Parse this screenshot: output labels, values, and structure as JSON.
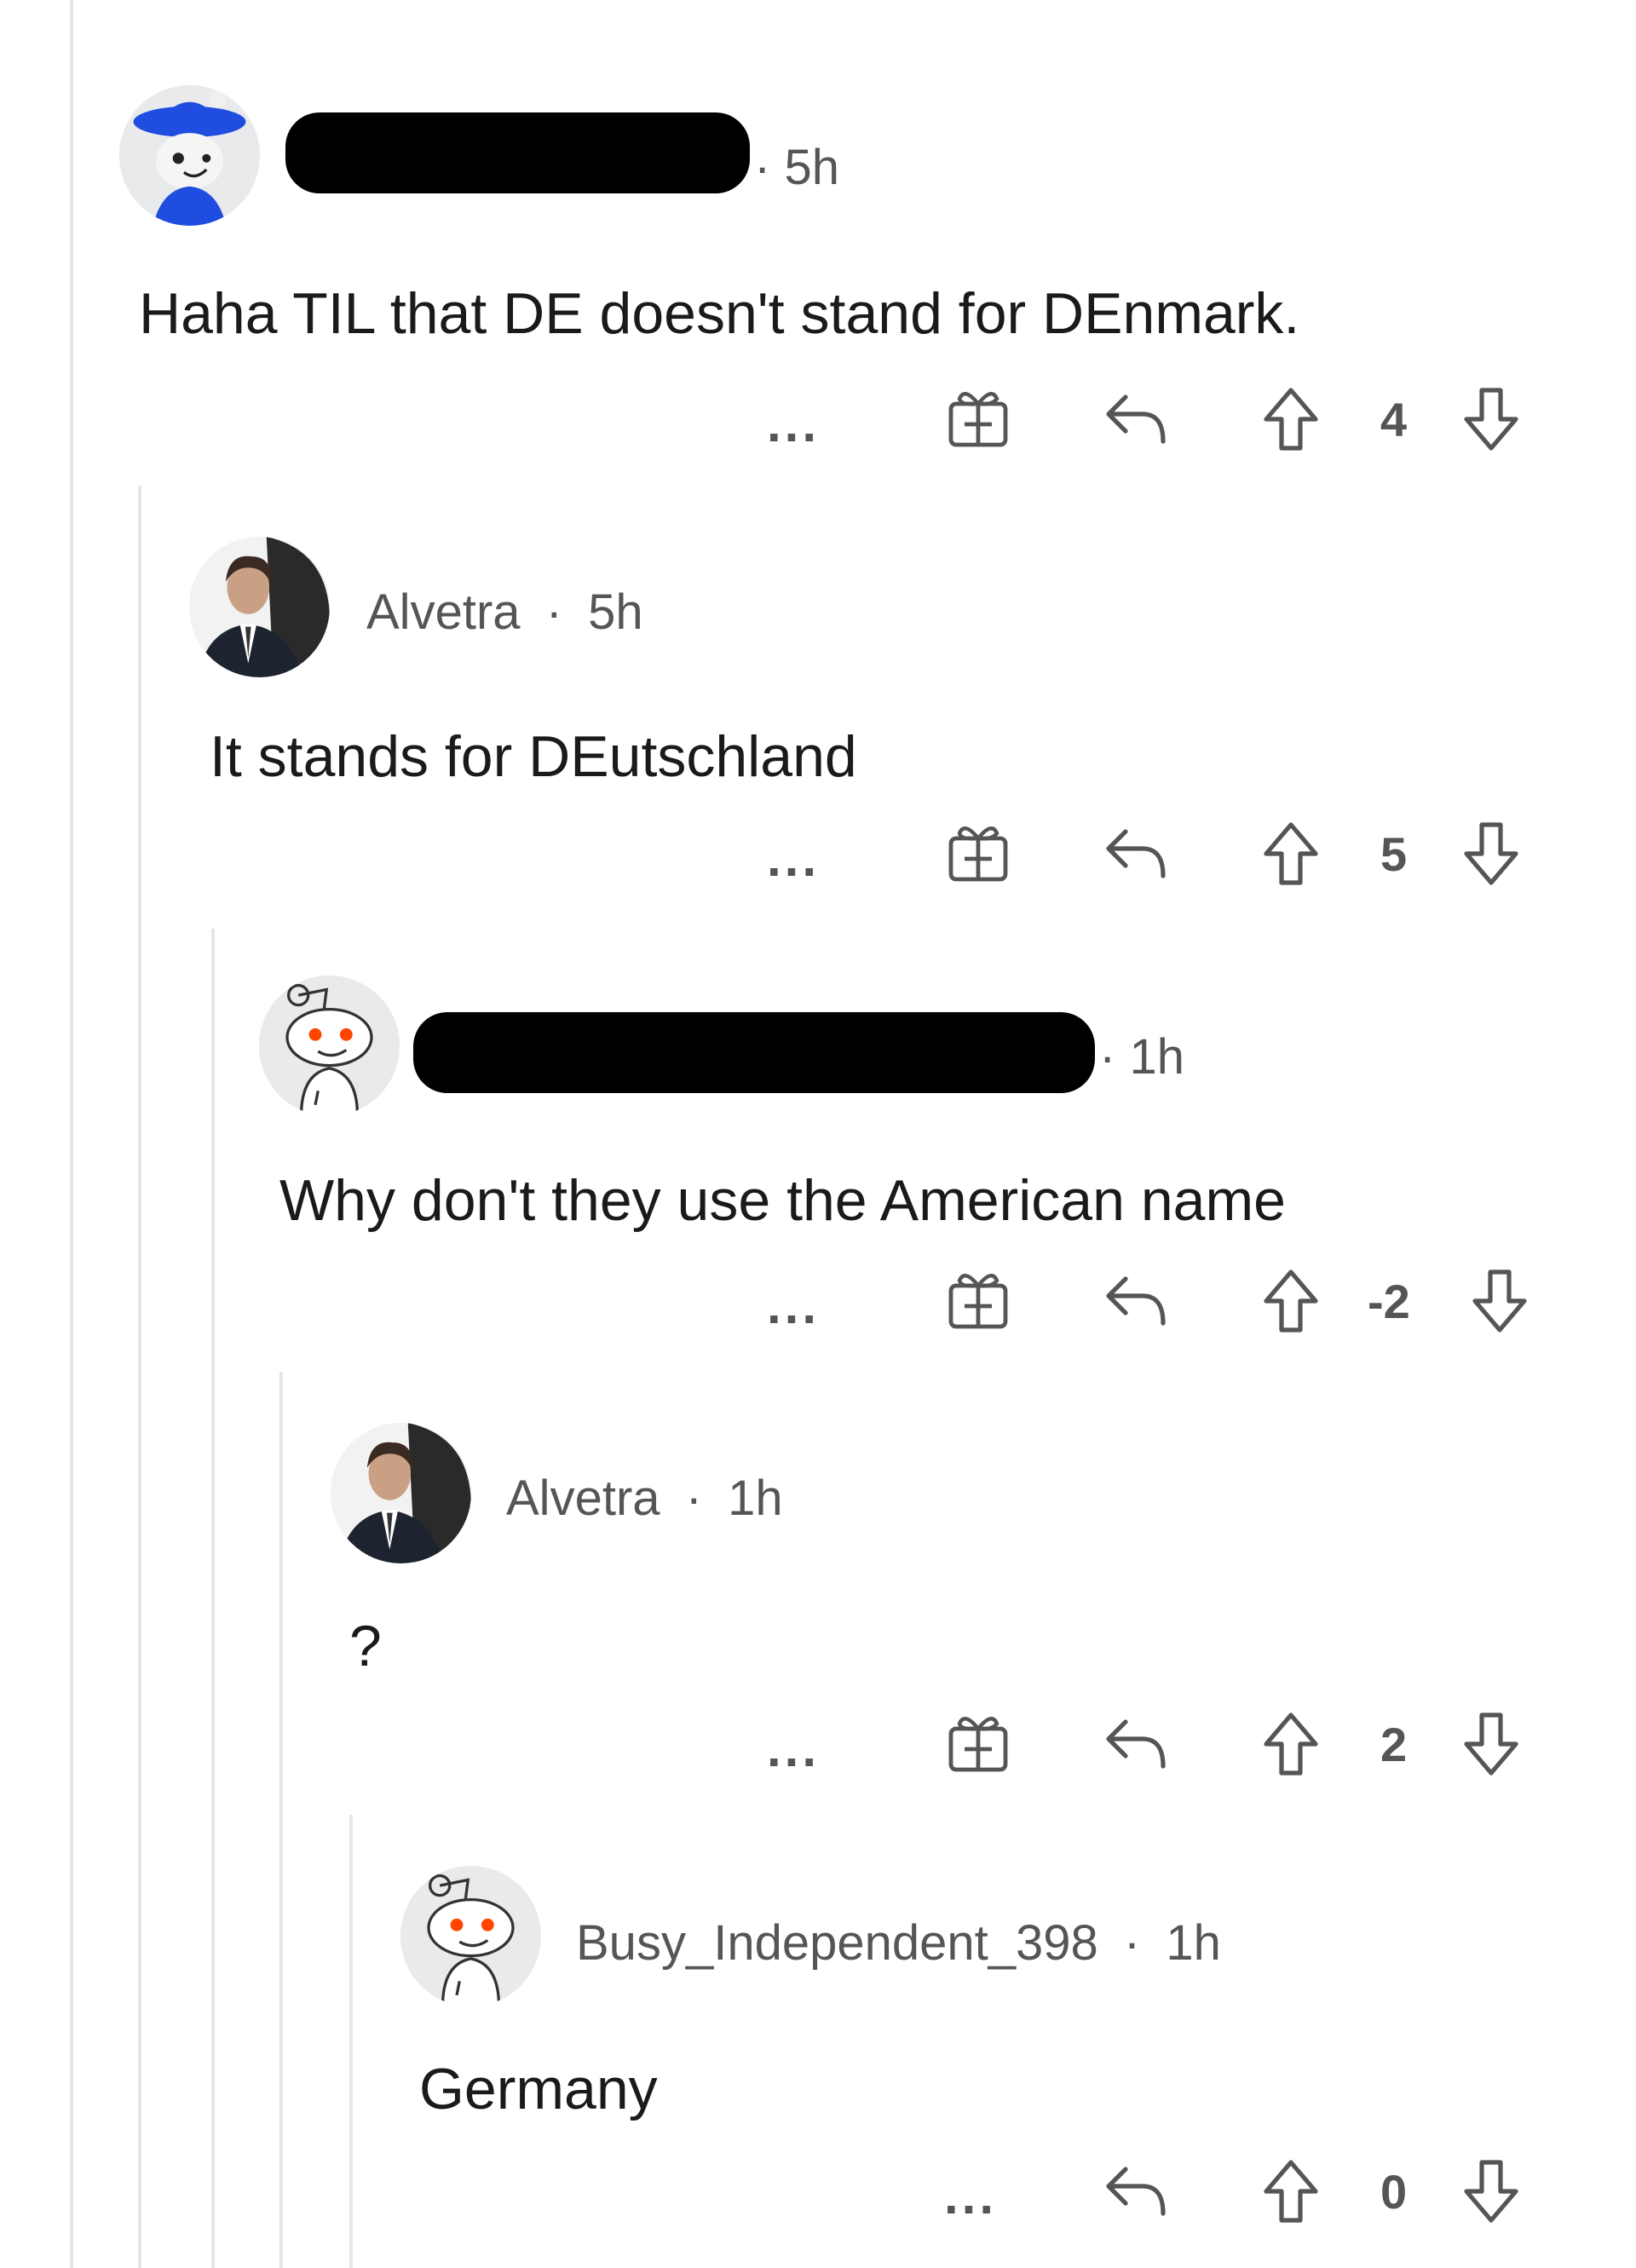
{
  "comments": [
    {
      "username": "",
      "time": "5h",
      "body": "Haha TIL that DE doesn't stand for DEnmark.",
      "score": "4",
      "more_label": "...",
      "avatar_icon": "blue-hat-avatar-icon",
      "redacted_username": true
    },
    {
      "username": "Alvetra",
      "time": "5h",
      "body": "It stands for DEutschland",
      "score": "5",
      "more_label": "...",
      "avatar_icon": "man-in-suit-avatar-icon",
      "redacted_username": false
    },
    {
      "username": "",
      "time": "1h",
      "body": "Why don't they use the American name",
      "score": "-2",
      "more_label": "...",
      "avatar_icon": "snoo-avatar-icon",
      "redacted_username": true
    },
    {
      "username": "Alvetra",
      "time": "1h",
      "body": "?",
      "score": "2",
      "more_label": "...",
      "avatar_icon": "man-in-suit-avatar-icon",
      "redacted_username": false
    },
    {
      "username": "Busy_Independent_398",
      "time": "1h",
      "body": "Germany",
      "score": "0",
      "more_label": "...",
      "avatar_icon": "snoo-avatar-icon",
      "redacted_username": false
    }
  ],
  "separator": "·",
  "colors": {
    "thread_line": "#e6e6e6",
    "meta_text": "#555555",
    "body_text": "#1a1a1a",
    "redaction": "#000000"
  }
}
